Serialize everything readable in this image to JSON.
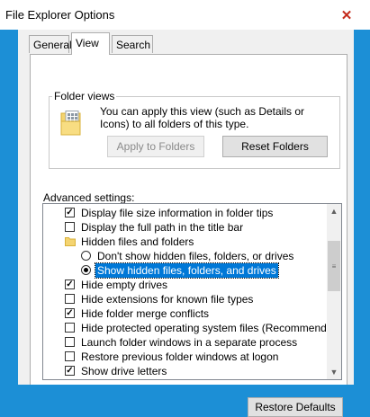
{
  "window": {
    "title": "File Explorer Options",
    "close_glyph": "✕"
  },
  "tabs": [
    {
      "label": "General"
    },
    {
      "label": "View"
    },
    {
      "label": "Search"
    }
  ],
  "folder_views": {
    "legend": "Folder views",
    "description": "You can apply this view (such as Details or Icons) to all folders of this type.",
    "apply_button": "Apply to Folders",
    "reset_button": "Reset Folders"
  },
  "advanced": {
    "label": "Advanced settings:",
    "items": [
      {
        "type": "checkbox",
        "checked": true,
        "label": "Display file size information in folder tips"
      },
      {
        "type": "checkbox",
        "checked": false,
        "label": "Display the full path in the title bar"
      },
      {
        "type": "folder",
        "label": "Hidden files and folders"
      },
      {
        "type": "radio",
        "checked": false,
        "label": "Don't show hidden files, folders, or drives"
      },
      {
        "type": "radio",
        "checked": true,
        "label": "Show hidden files, folders, and drives",
        "selected": true
      },
      {
        "type": "checkbox",
        "checked": true,
        "label": "Hide empty drives"
      },
      {
        "type": "checkbox",
        "checked": false,
        "label": "Hide extensions for known file types"
      },
      {
        "type": "checkbox",
        "checked": true,
        "label": "Hide folder merge conflicts"
      },
      {
        "type": "checkbox",
        "checked": false,
        "label": "Hide protected operating system files (Recommended)"
      },
      {
        "type": "checkbox",
        "checked": false,
        "label": "Launch folder windows in a separate process"
      },
      {
        "type": "checkbox",
        "checked": false,
        "label": "Restore previous folder windows at logon"
      },
      {
        "type": "checkbox",
        "checked": true,
        "label": "Show drive letters"
      }
    ]
  },
  "restore_defaults": "Restore Defaults",
  "colors": {
    "accent": "#0078d7",
    "titlebar_bg": "#1c8fd6",
    "close": "#c42b1c"
  },
  "icons": {
    "close": "close-icon",
    "folder_views": "folder-view-icon",
    "folder": "folder-icon",
    "scroll_up": "chevron-up-icon",
    "scroll_down": "chevron-down-icon",
    "grip": "grip-icon"
  }
}
